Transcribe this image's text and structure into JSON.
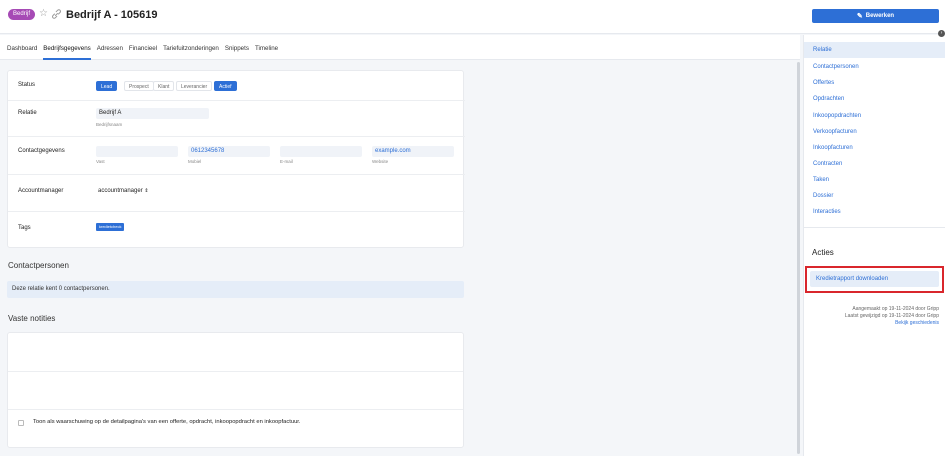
{
  "header": {
    "badge": "Bedrijf",
    "title": "Bedrijf A - 105619",
    "edit_button": "Bewerken"
  },
  "tabs": [
    "Dashboard",
    "Bedrijfsgegevens",
    "Adressen",
    "Financieel",
    "Tariefuitzonderingen",
    "Snippets",
    "Timeline"
  ],
  "active_tab": "Bedrijfsgegevens",
  "form": {
    "status": {
      "label": "Status",
      "options": [
        "Lead",
        "Prospect",
        "Klant",
        "Leverancier",
        "Actief"
      ],
      "selected": [
        "Lead",
        "Actief"
      ]
    },
    "relatie": {
      "label": "Relatie",
      "value": "Bedrijf A",
      "sublabel": "Bedrijfsnaam"
    },
    "contact": {
      "label": "Contactgegevens",
      "fields": [
        {
          "value": "",
          "sublabel": "Vast"
        },
        {
          "value": "0612345678",
          "sublabel": "Mobiel"
        },
        {
          "value": "",
          "sublabel": "E-mail"
        },
        {
          "value": "example.com",
          "sublabel": "Website"
        }
      ]
    },
    "accountmanager": {
      "label": "Accountmanager",
      "value": "accountmanager"
    },
    "tags": {
      "label": "Tags",
      "items": [
        "kredietcheck"
      ]
    }
  },
  "contactpersonen": {
    "title": "Contactpersonen",
    "info": "Deze relatie kent 0 contactpersonen."
  },
  "notes": {
    "title": "Vaste notities",
    "checkbox_label": "Toon als waarschuwing op de detailpagina's van een offerte, opdracht, inkoopopdracht en inkoopfactuur."
  },
  "sidebar": {
    "items": [
      "Relatie",
      "Contactpersonen",
      "Offertes",
      "Opdrachten",
      "Inkoopopdrachten",
      "Verkoopfacturen",
      "Inkoopfacturen",
      "Contracten",
      "Taken",
      "Dossier",
      "Interacties"
    ],
    "active": "Relatie",
    "acties_title": "Acties",
    "download_button": "Kredietrapport downloaden",
    "created": "Aangemaakt op 19-11-2024 door Gripp",
    "modified": "Laatst gewijzigd op 19-11-2024 door Gripp",
    "history_link": "Bekijk geschiedenis"
  },
  "colors": {
    "accent": "#2d6fd6",
    "badge": "#a64ab5",
    "highlight": "#d9262c"
  }
}
